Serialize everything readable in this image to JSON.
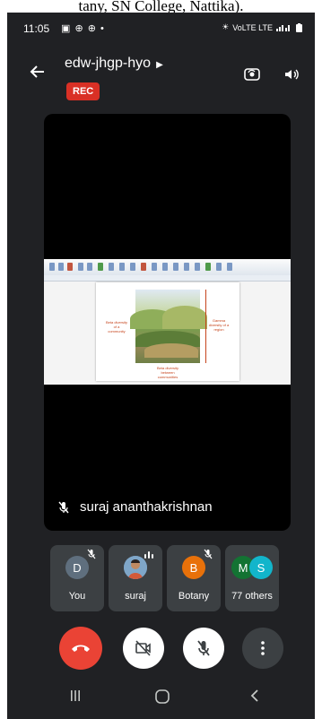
{
  "caption": {
    "text": "tany, SN College, Nattika)."
  },
  "status_bar": {
    "time": "11:05",
    "network": "VoLTE LTE"
  },
  "header": {
    "meeting_code": "edw-jhgp-hyo",
    "rec_label": "REC"
  },
  "presentation": {
    "left_label": "Beta diversity of a community",
    "right_label": "Gamma diversity of a region",
    "bottom_label": "Beta diversity between communities"
  },
  "main_tile": {
    "speaker_name": "suraj ananthakrishnan"
  },
  "participants": [
    {
      "initial": "D",
      "label": "You",
      "color": "#5f6f7e"
    },
    {
      "initial": "",
      "label": "suraj",
      "color": "#6b8fb0"
    },
    {
      "initial": "B",
      "label": "Botany",
      "color": "#e8710a"
    },
    {
      "initial": "M",
      "initial2": "S",
      "label": "77 others",
      "color": "#137333",
      "color2": "#12b5cb"
    }
  ],
  "colors": {
    "background": "#202124",
    "tile": "#3c4043",
    "end_call": "#ea4335",
    "rec": "#d93025"
  },
  "icons": [
    "back-arrow-icon",
    "chevron-right-icon",
    "flip-camera-icon",
    "speaker-icon",
    "mic-off-icon",
    "audio-bars-icon",
    "end-call-icon",
    "camera-off-icon",
    "more-vert-icon",
    "recents-icon",
    "home-icon",
    "nav-back-icon"
  ]
}
